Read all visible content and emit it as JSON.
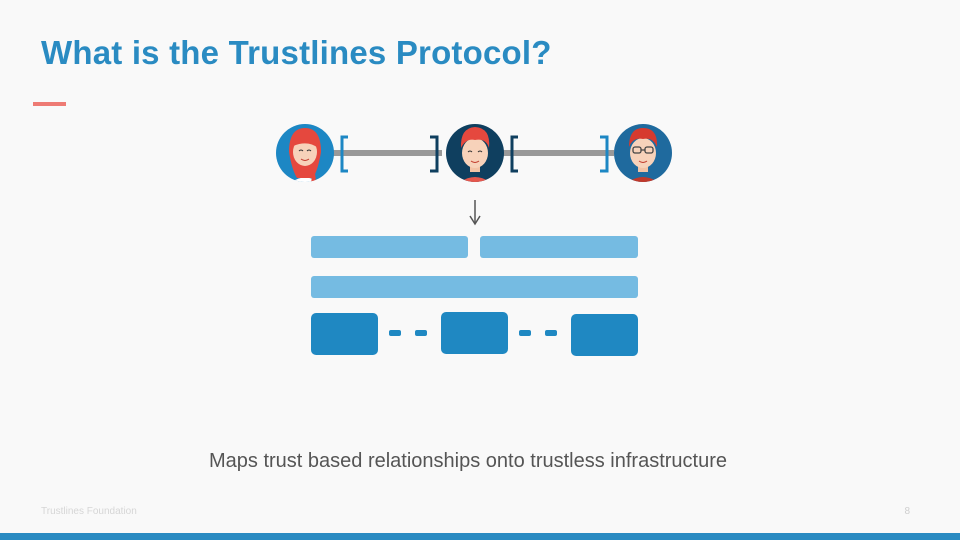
{
  "slide": {
    "title": "What is the Trustlines Protocol?",
    "caption": "Maps trust based relationships onto trustless infrastructure",
    "footer": "Trustlines Foundation",
    "page_number": "8"
  },
  "colors": {
    "title": "#2a8bc2",
    "accent": "#ee7b74",
    "block_light": "#75bbe2",
    "block_dark": "#1f88c2",
    "trustline": "#999999",
    "bracket_left": "#1d87c4",
    "bracket_right": "#0f3f5f",
    "bottom_bar": "#2a8bc2"
  },
  "diagram": {
    "avatars": [
      {
        "name": "woman-avatar-icon"
      },
      {
        "name": "man-avatar-icon"
      },
      {
        "name": "man-glasses-avatar-icon"
      }
    ],
    "trustlines": 2,
    "arrow": "down-arrow-icon"
  }
}
